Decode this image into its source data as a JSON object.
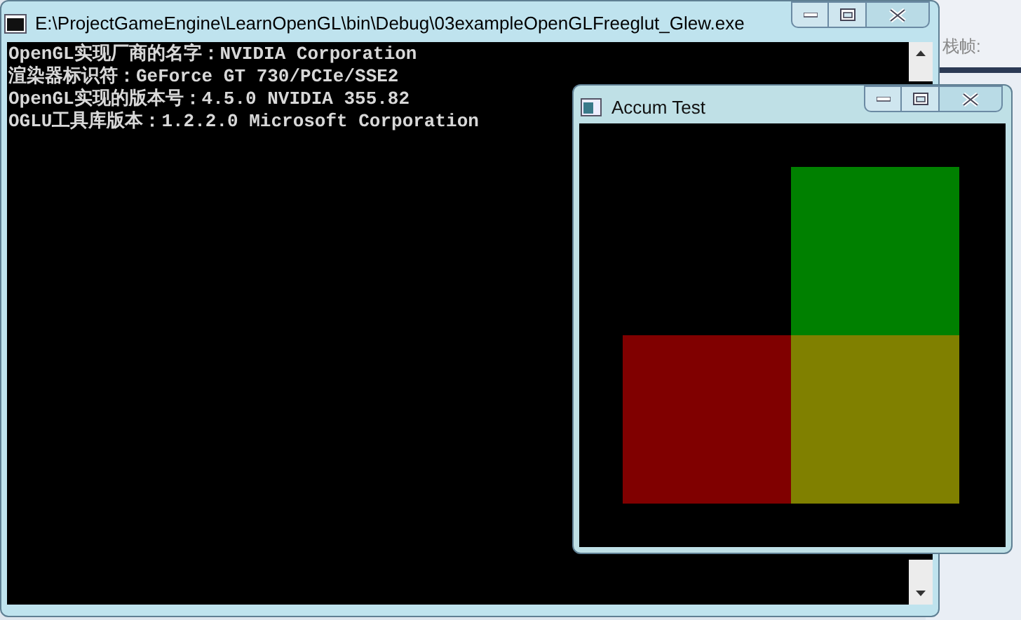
{
  "background_app": {
    "toolbar_label": "栈帧:"
  },
  "console_window": {
    "title": "E:\\ProjectGameEngine\\LearnOpenGL\\bin\\Debug\\03exampleOpenGLFreeglut_Glew.exe",
    "lines": [
      "OpenGL实现厂商的名字：NVIDIA Corporation",
      "渲染器标识符：GeForce GT 730/PCIe/SSE2",
      "OpenGL实现的版本号：4.5.0 NVIDIA 355.82",
      "OGLU工具库版本：1.2.2.0 Microsoft Corporation"
    ]
  },
  "glut_window": {
    "title": "Accum Test",
    "square_rows": [
      [
        {
          "kind": "empty"
        },
        {
          "kind": "filled",
          "color": "#008000"
        }
      ],
      [
        {
          "kind": "filled",
          "color": "#800000"
        },
        {
          "kind": "filled",
          "color": "#808000"
        }
      ]
    ]
  }
}
